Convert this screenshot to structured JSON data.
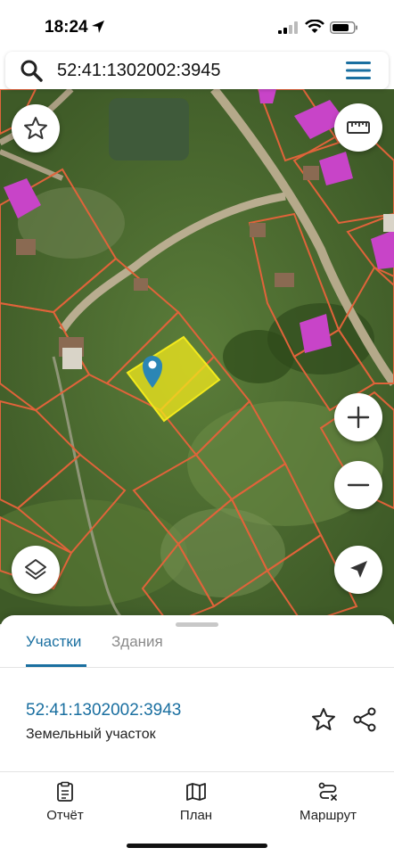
{
  "status_bar": {
    "time": "18:24",
    "icons": [
      "location-arrow-icon",
      "signal-icon",
      "wifi-icon",
      "battery-icon"
    ]
  },
  "search": {
    "value": "52:41:1302002:3945",
    "icon": "search-icon",
    "menu_icon": "hamburger-menu-icon"
  },
  "map": {
    "controls": [
      "favorite-star-icon",
      "ruler-icon",
      "layers-icon",
      "zoom-in-icon",
      "zoom-out-icon",
      "navigate-arrow-icon"
    ],
    "colors": {
      "parcel_border": "#e0633a",
      "selected_fill": "#f3ea1c",
      "building_roof": "#c844c8",
      "pin": "#2b86b5"
    }
  },
  "sheet": {
    "tabs": [
      {
        "label": "Участки",
        "active": true
      },
      {
        "label": "Здания",
        "active": false
      }
    ],
    "parcel": {
      "id": "52:41:1302002:3943",
      "type": "Земельный участок"
    },
    "actions": [
      "star-outline-icon",
      "share-icon"
    ],
    "accent": "#1a6fa0"
  },
  "bottom_nav": {
    "items": [
      {
        "label": "Отчёт",
        "icon": "report-icon"
      },
      {
        "label": "План",
        "icon": "map-plan-icon"
      },
      {
        "label": "Маршрут",
        "icon": "route-icon"
      }
    ]
  }
}
